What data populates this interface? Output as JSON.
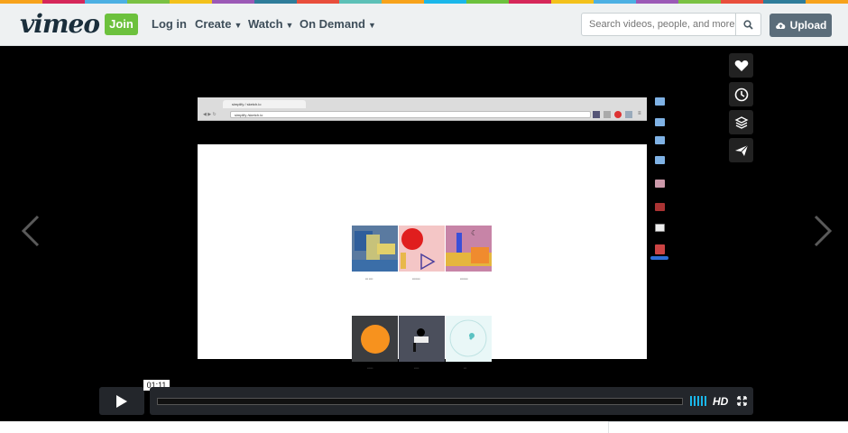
{
  "colors": {
    "stripe": [
      "#f7a31c",
      "#d6285a",
      "#4cb0e3",
      "#7ac143",
      "#f3c11b",
      "#9b59b6",
      "#2e7d9a",
      "#e84e3c",
      "#5cc0b7",
      "#f7a31c",
      "#1ab7ea",
      "#6cc13d",
      "#d6285a",
      "#f3c11b",
      "#4cb0e3",
      "#9b59b6",
      "#7ac143",
      "#e84e3c",
      "#2e7d9a",
      "#f7a31c"
    ],
    "join": "#6cc13d",
    "upload": "#5b6d7a",
    "accent": "#1ab7ea"
  },
  "header": {
    "logo": "vimeo",
    "join_label": "Join",
    "nav": [
      {
        "label": "Log in",
        "has_menu": false
      },
      {
        "label": "Create",
        "has_menu": true
      },
      {
        "label": "Watch",
        "has_menu": true
      },
      {
        "label": "On Demand",
        "has_menu": true
      }
    ],
    "search_placeholder": "Search videos, people, and more",
    "search_icon": "search-icon",
    "upload_label": "Upload",
    "upload_icon": "cloud-upload-icon"
  },
  "sidebar_actions": [
    {
      "name": "like-button",
      "icon": "heart-icon"
    },
    {
      "name": "watch-later-button",
      "icon": "clock-icon"
    },
    {
      "name": "collections-button",
      "icon": "layers-icon"
    },
    {
      "name": "share-button",
      "icon": "paper-plane-icon"
    }
  ],
  "controls": {
    "time": "01:11",
    "hd_label": "HD",
    "progress": 0,
    "icons": [
      "play-icon",
      "volume-icon",
      "fullscreen-icon"
    ]
  },
  "video": {
    "tab_title": "simplify / sketch.io",
    "url": "simplify /sketch.io"
  }
}
